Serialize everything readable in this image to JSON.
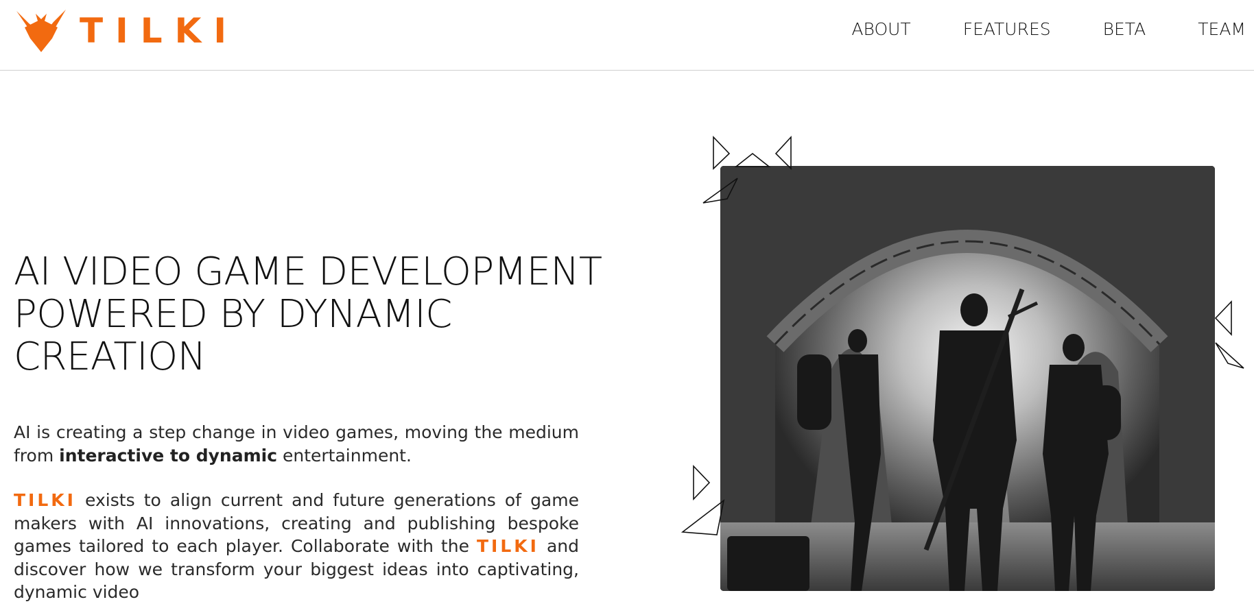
{
  "brand": {
    "name": "TILKI",
    "color": "#f26a10"
  },
  "nav": {
    "items": [
      {
        "label": "ABOUT"
      },
      {
        "label": "FEATURES"
      },
      {
        "label": "BETA"
      },
      {
        "label": "TEAM"
      }
    ]
  },
  "hero": {
    "title_lines": [
      "AI VIDEO GAME DEVELOPMENT",
      "POWERED BY DYNAMIC",
      "CREATION"
    ],
    "p1": {
      "text_a": "AI is creating a step change in video games, moving the medium from ",
      "bold": "interactive to dynamic",
      "text_b": " entertainment."
    },
    "p2": {
      "brand_a": "TILKI",
      "text_a": " exists to align current and future generations of game makers with AI innovations, creating and publishing bespoke games tailored to each player. Collaborate with the ",
      "brand_b": "TILKI",
      "text_b": " and discover how we transform your biggest ideas into captivating, dynamic video"
    },
    "image": {
      "description_icon": "adventurers-in-tunnel-image"
    }
  }
}
